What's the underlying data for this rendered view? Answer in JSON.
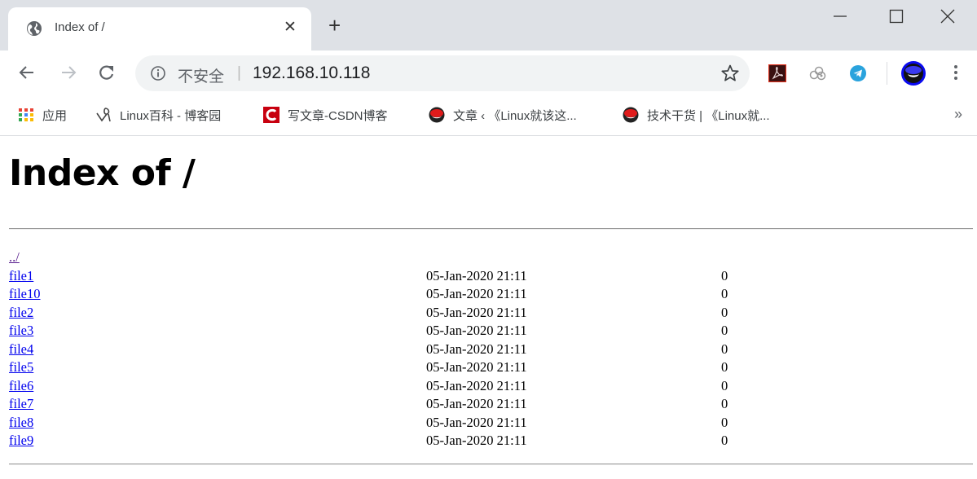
{
  "browser": {
    "tab": {
      "title": "Index of /",
      "favicon": "globe-icon"
    },
    "window_controls": [
      "minimize-icon",
      "maximize-icon",
      "close-icon"
    ],
    "toolbar": {
      "security_label": "不安全",
      "separator": "|",
      "url": "192.168.10.118",
      "extensions": [
        "adobe-acrobat-icon",
        "baidu-cloud-icon",
        "telegram-icon"
      ],
      "profile": "redhat-avatar-icon"
    },
    "bookmarks": [
      {
        "label": "应用",
        "icon": "apps-grid-icon"
      },
      {
        "label": "Linux百科 - 博客园",
        "icon": "cnblogs-icon"
      },
      {
        "label": "写文章-CSDN博客",
        "icon": "csdn-icon"
      },
      {
        "label": "文章 ‹ 《Linux就该这...",
        "icon": "redhat-icon"
      },
      {
        "label": "技术干货 | 《Linux就...",
        "icon": "redhat-icon"
      }
    ],
    "bookmarks_overflow": "»"
  },
  "page": {
    "heading": "Index of /",
    "parent_link": "../",
    "entries": [
      {
        "name": "file1",
        "date": "05-Jan-2020 21:11",
        "size": "0"
      },
      {
        "name": "file10",
        "date": "05-Jan-2020 21:11",
        "size": "0"
      },
      {
        "name": "file2",
        "date": "05-Jan-2020 21:11",
        "size": "0"
      },
      {
        "name": "file3",
        "date": "05-Jan-2020 21:11",
        "size": "0"
      },
      {
        "name": "file4",
        "date": "05-Jan-2020 21:11",
        "size": "0"
      },
      {
        "name": "file5",
        "date": "05-Jan-2020 21:11",
        "size": "0"
      },
      {
        "name": "file6",
        "date": "05-Jan-2020 21:11",
        "size": "0"
      },
      {
        "name": "file7",
        "date": "05-Jan-2020 21:11",
        "size": "0"
      },
      {
        "name": "file8",
        "date": "05-Jan-2020 21:11",
        "size": "0"
      },
      {
        "name": "file9",
        "date": "05-Jan-2020 21:11",
        "size": "0"
      }
    ]
  },
  "colors": {
    "link": "#0000ee",
    "visited_link": "#551a8b",
    "titlebar": "#dee1e6",
    "omnibox": "#f1f3f4"
  }
}
